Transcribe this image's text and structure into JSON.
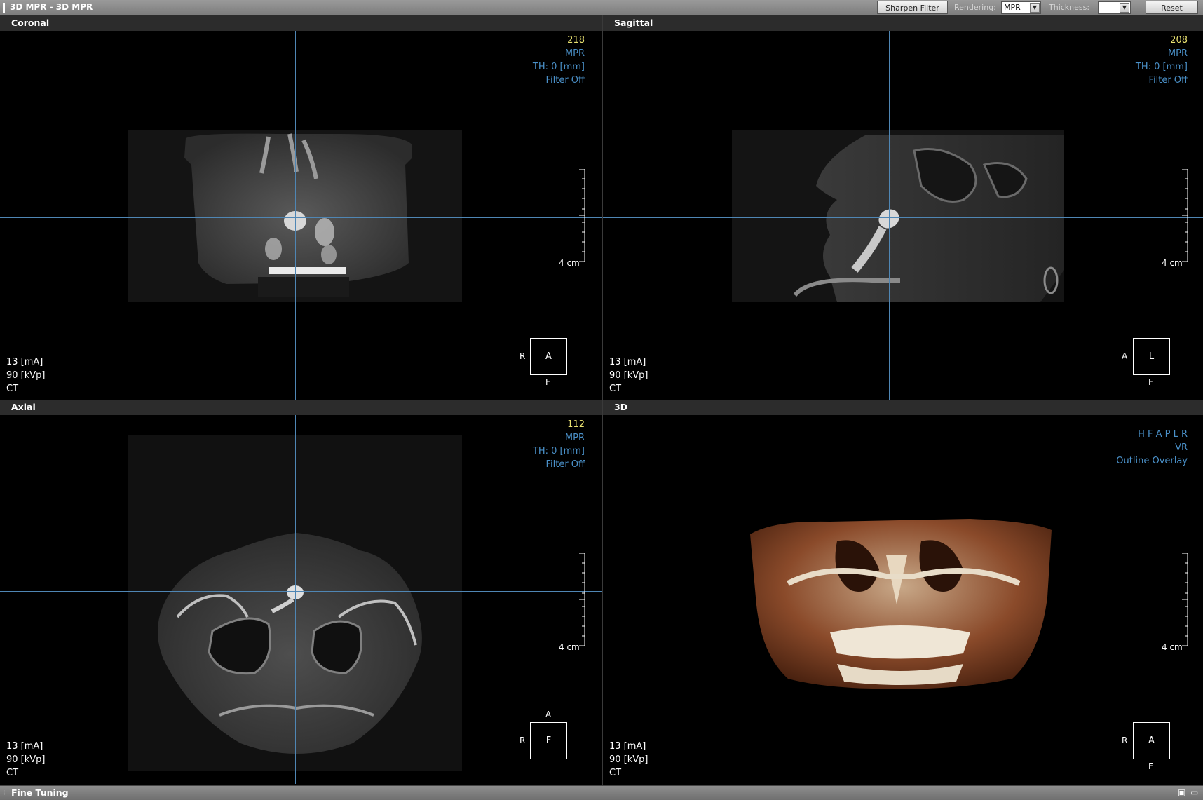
{
  "window": {
    "title": "3D MPR - 3D MPR",
    "sharpen_filter_label": "Sharpen Filter",
    "rendering_label": "Rendering:",
    "rendering_value": "MPR",
    "thickness_label": "Thickness:",
    "thickness_value": "",
    "reset_label": "Reset"
  },
  "viewports": {
    "coronal": {
      "title": "Coronal",
      "slice": "218",
      "mode": "MPR",
      "thickness": "TH: 0 [mm]",
      "filter": "Filter Off",
      "ruler": "4 cm",
      "ma": "13 [mA]",
      "kvp": "90 [kVp]",
      "modality": "CT",
      "orient_center": "A",
      "orient_left": "R",
      "orient_bottom": "F"
    },
    "sagittal": {
      "title": "Sagittal",
      "slice": "208",
      "mode": "MPR",
      "thickness": "TH: 0 [mm]",
      "filter": "Filter Off",
      "ruler": "4 cm",
      "ma": "13 [mA]",
      "kvp": "90 [kVp]",
      "modality": "CT",
      "orient_center": "L",
      "orient_left": "A",
      "orient_bottom": "F"
    },
    "axial": {
      "title": "Axial",
      "slice": "112",
      "mode": "MPR",
      "thickness": "TH: 0 [mm]",
      "filter": "Filter Off",
      "ruler": "4 cm",
      "ma": "13 [mA]",
      "kvp": "90 [kVp]",
      "modality": "CT",
      "orient_center": "F",
      "orient_left": "R",
      "orient_top": "A"
    },
    "vr3d": {
      "title": "3D",
      "directions": "H F A P L R",
      "render": "VR",
      "overlay": "Outline Overlay",
      "ruler": "4 cm",
      "ma": "13 [mA]",
      "kvp": "90 [kVp]",
      "modality": "CT",
      "orient_center": "A",
      "orient_left": "R",
      "orient_bottom": "F"
    }
  },
  "bottom": {
    "title": "Fine Tuning"
  },
  "icons": {
    "save": "save-icon",
    "folder": "folder-icon",
    "grip": "grip-icon"
  },
  "colors": {
    "crosshair": "#4f86b4",
    "info_blue": "#4a90c8",
    "slice_yellow": "#e8e070",
    "bone_render": "#8a4a2a"
  }
}
